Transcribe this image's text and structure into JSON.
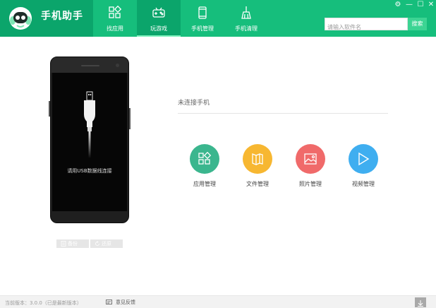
{
  "app": {
    "title": "手机助手"
  },
  "nav": {
    "tabs": [
      {
        "label": "找应用",
        "icon": "grid-apps-icon",
        "active": false
      },
      {
        "label": "玩游戏",
        "icon": "gamepad-icon",
        "active": true
      },
      {
        "label": "手机管理",
        "icon": "phone-icon",
        "active": false
      },
      {
        "label": "手机清理",
        "icon": "broom-icon",
        "active": false
      }
    ]
  },
  "window_controls": {
    "settings": "⚙",
    "minimize": "—",
    "maximize": "☐",
    "close": "✕"
  },
  "search": {
    "placeholder": "请输入软件名",
    "value": "",
    "button_label": "搜索"
  },
  "device": {
    "status": "未连接手机",
    "prompt": "请用USB数据线连接",
    "backup_label": "备份",
    "restore_label": "还原"
  },
  "tools": [
    {
      "label": "应用管理",
      "icon": "apps-icon",
      "color": "#3bb68e"
    },
    {
      "label": "文件管理",
      "icon": "folder-book-icon",
      "color": "#f7b731"
    },
    {
      "label": "照片管理",
      "icon": "picture-icon",
      "color": "#f06a6a"
    },
    {
      "label": "视频管理",
      "icon": "play-icon",
      "color": "#3faef0"
    }
  ],
  "footer": {
    "version": "当前版本：3.0.0（已是最新版本）",
    "feedback": "意见反馈"
  },
  "colors": {
    "header": "#16be7c",
    "header_dark": "#0ba56b",
    "search_button": "#3cd493"
  }
}
